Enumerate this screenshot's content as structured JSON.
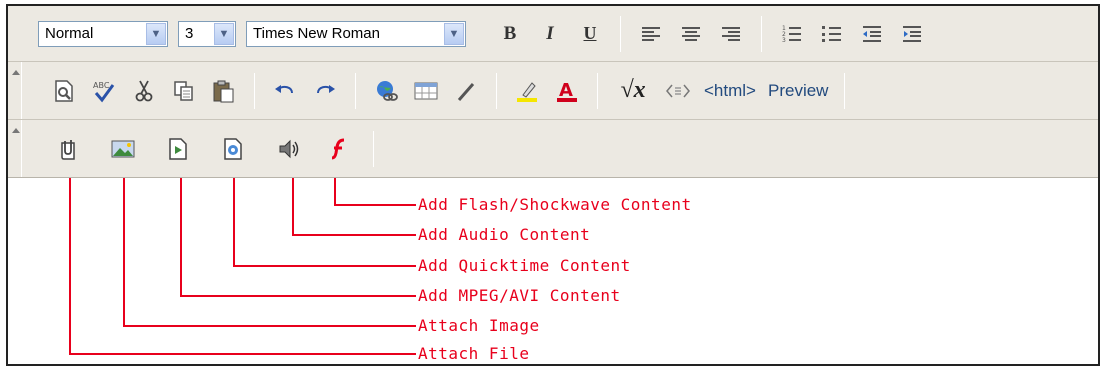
{
  "toolbar_row1": {
    "paragraph_format": "Normal",
    "font_size": "3",
    "font_name": "Times New Roman",
    "bold_label": "B",
    "italic_label": "I",
    "underline_label": "U"
  },
  "toolbar_row2": {
    "spellcheck_label": "ABC",
    "equation_label": "√x",
    "html_label": "<html>",
    "preview_label": "Preview"
  },
  "callouts": [
    {
      "label": "Add Flash/Shockwave Content"
    },
    {
      "label": "Add Audio Content"
    },
    {
      "label": "Add Quicktime Content"
    },
    {
      "label": "Add MPEG/AVI Content"
    },
    {
      "label": "Attach Image"
    },
    {
      "label": "Attach File"
    }
  ],
  "colors": {
    "callout": "#e8001c",
    "toolbar_bg": "#ece9e2",
    "highlight_bar": "#f5e600",
    "font_color_bar": "#d0001c"
  }
}
